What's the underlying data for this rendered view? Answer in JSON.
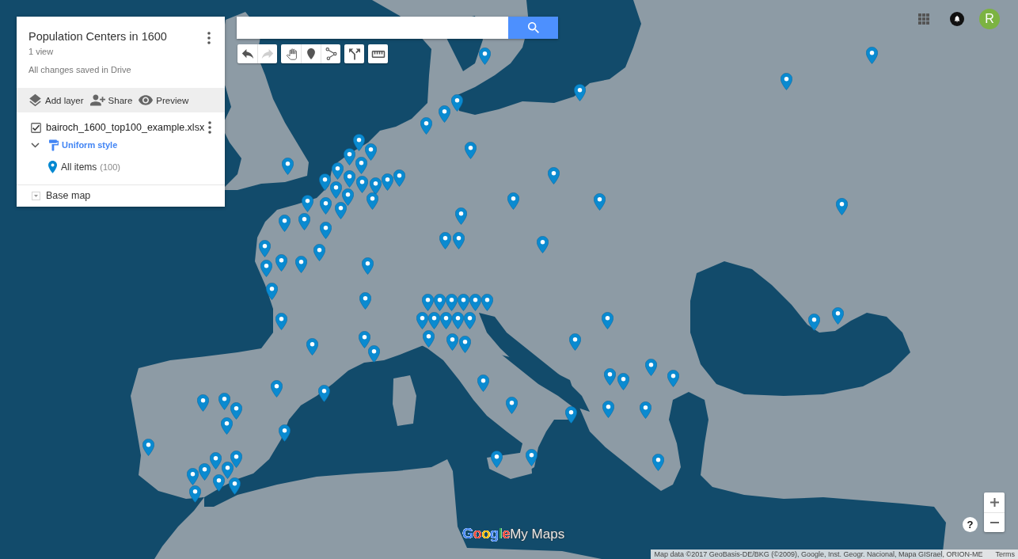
{
  "map_panel": {
    "title": "Population Centers in 1600",
    "views": "1 view",
    "save_status": "All changes saved in Drive",
    "actions": [
      {
        "kind": "add_layer",
        "label": "Add layer"
      },
      {
        "kind": "share",
        "label": "Share"
      },
      {
        "kind": "preview",
        "label": "Preview"
      }
    ],
    "layers": [
      {
        "name": "bairoch_1600_top100_example.xlsx",
        "checked": true,
        "expanded": true,
        "style_label": "Uniform style",
        "items_label": "All items",
        "items_count": "(100)"
      }
    ],
    "base_map": {
      "label": "Base map",
      "expanded": false
    }
  },
  "toolbar": [
    {
      "tools": [
        {
          "kind": "undo",
          "disabled": false
        },
        {
          "kind": "redo",
          "disabled": true
        }
      ]
    },
    {
      "tools": [
        {
          "kind": "pan",
          "disabled": false
        },
        {
          "kind": "marker",
          "disabled": false
        },
        {
          "kind": "line",
          "disabled": false
        }
      ]
    },
    {
      "tools": [
        {
          "kind": "directions",
          "disabled": false
        }
      ]
    },
    {
      "tools": [
        {
          "kind": "measure",
          "disabled": false
        }
      ]
    }
  ],
  "account": {
    "initial": "R"
  },
  "help": "?",
  "logo": {
    "brand": "Google",
    "product": "My Maps"
  },
  "attribution": {
    "text": "Map data ©2017 GeoBasis-DE/BKG (©2009), Google, Inst. Geogr. Nacional, Mapa GISrael, ORION-ME",
    "terms": "Terms"
  }
}
